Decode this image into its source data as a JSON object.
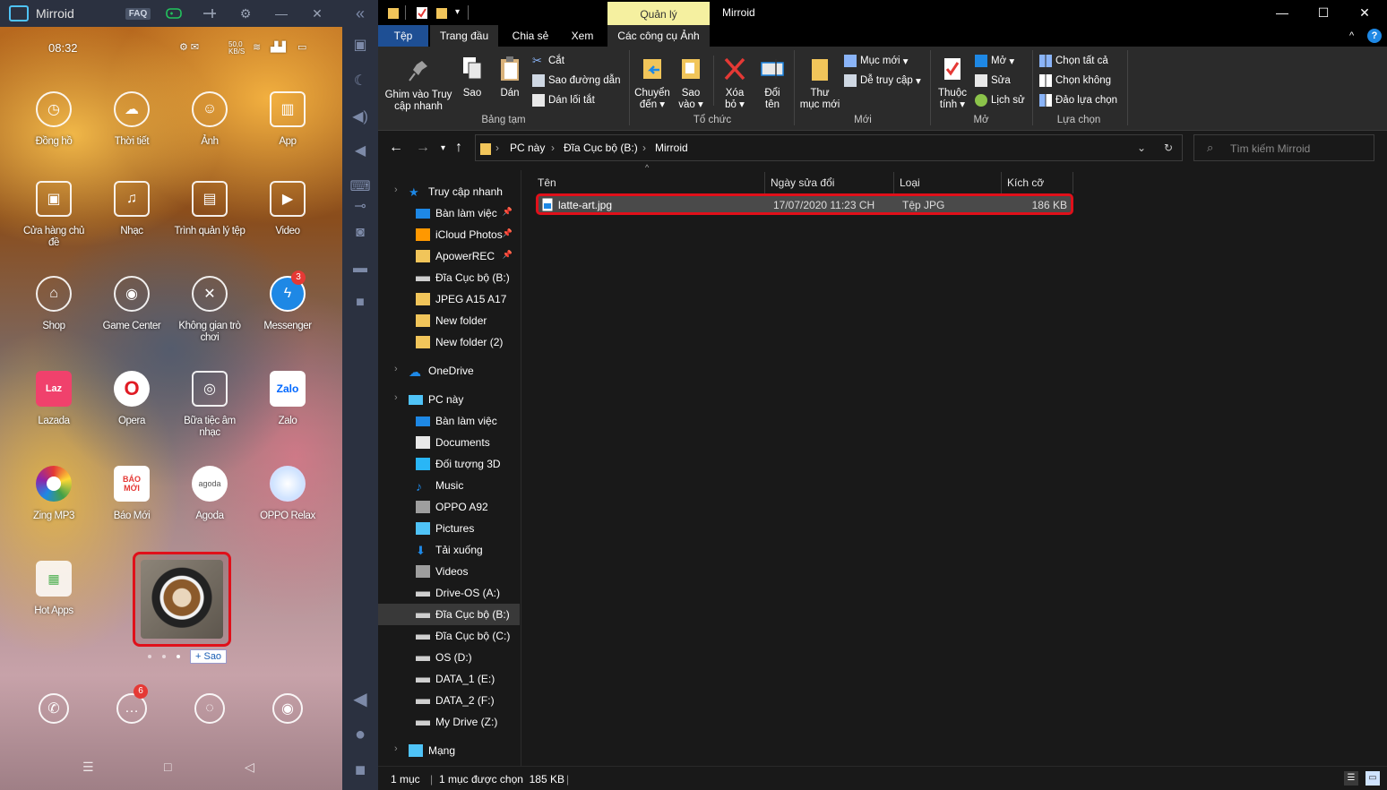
{
  "phone": {
    "app_title": "Mirroid",
    "faq_label": "FAQ",
    "status_time": "08:32",
    "status_speed": "50,0\nKB/S",
    "apps": [
      {
        "label": "Đồng hồ"
      },
      {
        "label": "Thời tiết"
      },
      {
        "label": "Ảnh"
      },
      {
        "label": "App"
      },
      {
        "label": "Cửa hàng chủ đề"
      },
      {
        "label": "Nhạc"
      },
      {
        "label": "Trình quản lý tệp"
      },
      {
        "label": "Video"
      },
      {
        "label": "Shop"
      },
      {
        "label": "Game Center"
      },
      {
        "label": "Không gian trò chơi"
      },
      {
        "label": "Messenger",
        "badge": "3"
      },
      {
        "label": "Lazada",
        "icon_text": "Laz"
      },
      {
        "label": "Opera"
      },
      {
        "label": "Bữa tiệc âm nhạc"
      },
      {
        "label": "Zalo",
        "icon_text": "Zalo"
      },
      {
        "label": "Zing MP3"
      },
      {
        "label": "Báo Mới",
        "icon_text": "BÁO MỚI"
      },
      {
        "label": "Agoda",
        "icon_text": "agoda"
      },
      {
        "label": "OPPO Relax"
      },
      {
        "label": "Hot Apps"
      }
    ],
    "dock_badge": "6",
    "copy_tooltip": "+ Sao"
  },
  "explorer": {
    "window_title": "Mirroid",
    "context_tab": "Quản lý",
    "tabs": [
      "Tệp",
      "Trang đầu",
      "Chia sẻ",
      "Xem",
      "Các công cụ Ảnh"
    ],
    "ribbon": {
      "pin_quick": "Ghim vào Truy cập nhanh",
      "copy": "Sao",
      "paste": "Dán",
      "cut": "Cắt",
      "copy_path": "Sao đường dẫn",
      "paste_shortcut": "Dán lối tắt",
      "group_clipboard": "Bảng tạm",
      "move_to": "Chuyển đến",
      "copy_to": "Sao vào",
      "delete": "Xóa bỏ",
      "rename": "Đổi tên",
      "group_organize": "Tổ chức",
      "new_folder": "Thư mục mới",
      "new_item": "Mục mới",
      "easy_access": "Dễ truy cập",
      "group_new": "Mới",
      "properties": "Thuộc tính",
      "open": "Mở",
      "edit": "Sửa",
      "history": "Lịch sử",
      "group_open": "Mở",
      "select_all": "Chọn tất cả",
      "select_none": "Chọn không",
      "invert_selection": "Đảo lựa chọn",
      "group_select": "Lựa chọn"
    },
    "address": {
      "crumbs": [
        "PC này",
        "Đĩa Cục bộ (B:)",
        "Mirroid"
      ]
    },
    "search_placeholder": "Tìm kiếm Mirroid",
    "nav": [
      {
        "label": "Truy cập nhanh",
        "icon": "star-icon"
      },
      {
        "label": "Bàn làm việc",
        "icon": "desktop-icon",
        "pinned": true
      },
      {
        "label": "iCloud Photos",
        "icon": "icloud-photos-icon",
        "pinned": true
      },
      {
        "label": "ApowerREC",
        "icon": "folder-icon",
        "pinned": true
      },
      {
        "label": "Đĩa Cục bộ (B:)",
        "icon": "drive-icon"
      },
      {
        "label": "JPEG A15 A17",
        "icon": "folder-icon"
      },
      {
        "label": "New folder",
        "icon": "folder-icon"
      },
      {
        "label": "New folder (2)",
        "icon": "folder-icon"
      },
      {
        "label": "OneDrive",
        "icon": "cloud-icon"
      },
      {
        "label": "PC này",
        "icon": "pc-icon"
      },
      {
        "label": "Bàn làm việc",
        "icon": "desktop-icon"
      },
      {
        "label": "Documents",
        "icon": "documents-icon"
      },
      {
        "label": "Đối tượng 3D",
        "icon": "3d-objects-icon"
      },
      {
        "label": "Music",
        "icon": "music-icon"
      },
      {
        "label": "OPPO A92",
        "icon": "phone-icon"
      },
      {
        "label": "Pictures",
        "icon": "pictures-icon"
      },
      {
        "label": "Tải xuống",
        "icon": "download-icon"
      },
      {
        "label": "Videos",
        "icon": "videos-icon"
      },
      {
        "label": "Drive-OS (A:)",
        "icon": "drive-icon"
      },
      {
        "label": "Đĩa Cục bộ (B:)",
        "icon": "drive-icon",
        "selected": true
      },
      {
        "label": "Đĩa Cục bộ (C:)",
        "icon": "drive-icon"
      },
      {
        "label": "OS (D:)",
        "icon": "drive-icon"
      },
      {
        "label": "DATA_1 (E:)",
        "icon": "drive-icon"
      },
      {
        "label": "DATA_2 (F:)",
        "icon": "drive-icon"
      },
      {
        "label": "My Drive (Z:)",
        "icon": "drive-icon"
      },
      {
        "label": "Mạng",
        "icon": "network-icon"
      }
    ],
    "columns": [
      "Tên",
      "Ngày sửa đổi",
      "Loại",
      "Kích cỡ"
    ],
    "files": [
      {
        "name": "latte-art.jpg",
        "modified": "17/07/2020 11:23 CH",
        "type": "Tệp JPG",
        "size": "186 KB"
      }
    ],
    "status": {
      "count": "1 mục",
      "selected": "1 mục được chọn  185 KB"
    },
    "colors": {
      "file_tab": "#1e4f94",
      "context_tab": "#f5f0a0",
      "highlight": "#e0101a"
    }
  }
}
